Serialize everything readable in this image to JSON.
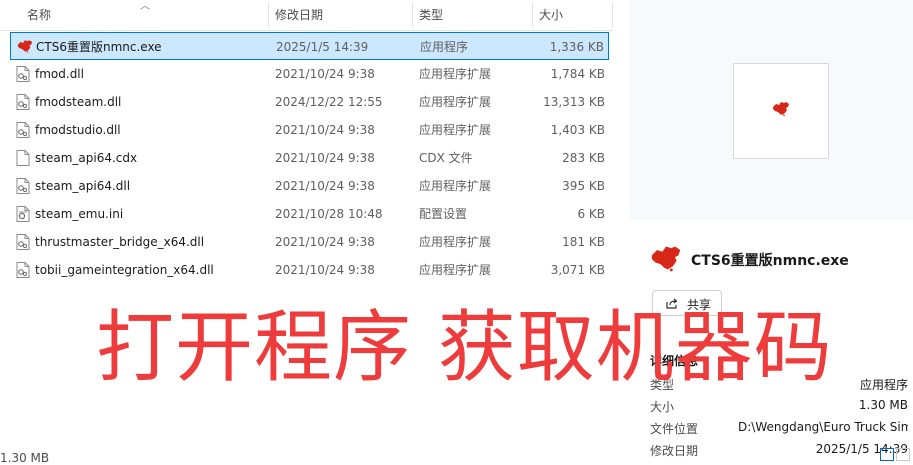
{
  "header": {
    "name": "名称",
    "date": "修改日期",
    "type": "类型",
    "size": "大小"
  },
  "files": [
    {
      "name": "CTS6重置版nmnc.exe",
      "date": "2025/1/5 14:39",
      "type": "应用程序",
      "size": "1,336 KB",
      "icon": "exe-map-icon",
      "selected": true
    },
    {
      "name": "fmod.dll",
      "date": "2021/10/24 9:38",
      "type": "应用程序扩展",
      "size": "1,784 KB",
      "icon": "dll-icon"
    },
    {
      "name": "fmodsteam.dll",
      "date": "2024/12/22 12:55",
      "type": "应用程序扩展",
      "size": "13,313 KB",
      "icon": "dll-icon"
    },
    {
      "name": "fmodstudio.dll",
      "date": "2021/10/24 9:38",
      "type": "应用程序扩展",
      "size": "1,403 KB",
      "icon": "dll-icon"
    },
    {
      "name": "steam_api64.cdx",
      "date": "2021/10/24 9:38",
      "type": "CDX 文件",
      "size": "283 KB",
      "icon": "file-icon"
    },
    {
      "name": "steam_api64.dll",
      "date": "2021/10/24 9:38",
      "type": "应用程序扩展",
      "size": "395 KB",
      "icon": "dll-icon"
    },
    {
      "name": "steam_emu.ini",
      "date": "2021/10/28 10:48",
      "type": "配置设置",
      "size": "6 KB",
      "icon": "ini-icon"
    },
    {
      "name": "thrustmaster_bridge_x64.dll",
      "date": "2021/10/24 9:38",
      "type": "应用程序扩展",
      "size": "181 KB",
      "icon": "dll-icon"
    },
    {
      "name": "tobii_gameintegration_x64.dll",
      "date": "2021/10/24 9:38",
      "type": "应用程序扩展",
      "size": "3,071 KB",
      "icon": "dll-icon"
    }
  ],
  "preview": {
    "filename": "CTS6重置版nmnc.exe",
    "share_label": "共享",
    "details_title": "详细信息",
    "props": [
      {
        "key": "类型",
        "value": "应用程序"
      },
      {
        "key": "大小",
        "value": "1.30 MB"
      },
      {
        "key": "文件位置",
        "value": "D:\\Wengdang\\Euro Truck Sim..."
      },
      {
        "key": "修改日期",
        "value": "2025/1/5 14:39"
      }
    ]
  },
  "overlay": "打开程序 获取机器码",
  "status": {
    "selected_size": "1.30 MB"
  },
  "colors": {
    "overlay": "#ee3b3b",
    "selection": "#cce8ff",
    "accent": "#0078d4",
    "map_red": "#d62718"
  }
}
